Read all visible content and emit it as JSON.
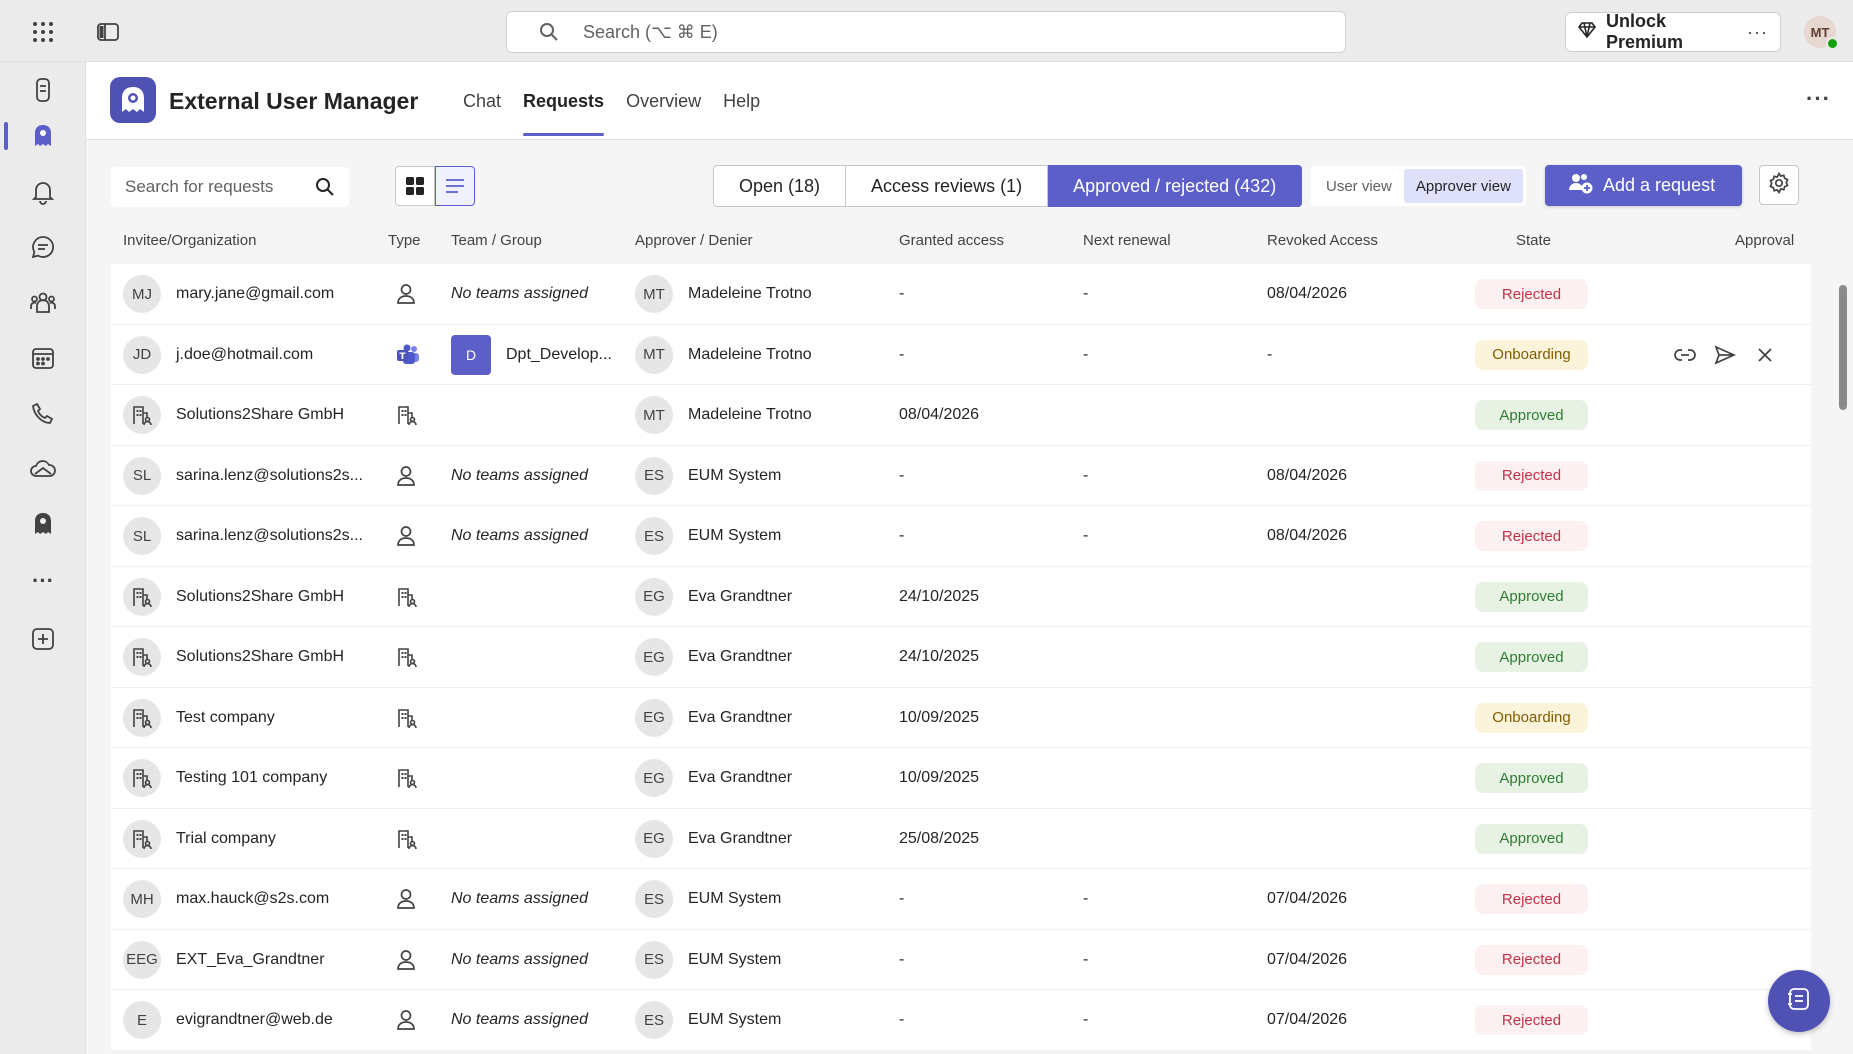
{
  "topbar": {
    "search_placeholder": "Search (⌥ ⌘ E)",
    "premium_label": "Unlock Premium",
    "more_label": "···",
    "avatar_initials": "MT"
  },
  "rail": {
    "items": [
      "app-icon",
      "external-user-manager-icon",
      "bell-icon",
      "chat-icon",
      "teams-icon",
      "calendar-icon",
      "phone-icon",
      "onedrive-icon",
      "app-icon",
      "more-icon",
      "add-app-icon"
    ],
    "more_label": "···"
  },
  "app": {
    "title": "External User Manager",
    "tabs": [
      {
        "label": "Chat"
      },
      {
        "label": "Requests"
      },
      {
        "label": "Overview"
      },
      {
        "label": "Help"
      }
    ],
    "more_label": "···"
  },
  "toolbar": {
    "search_placeholder": "Search for requests",
    "filters": [
      {
        "label": "Open (18)"
      },
      {
        "label": "Access reviews (1)"
      },
      {
        "label": "Approved / rejected (432)"
      }
    ],
    "views": [
      {
        "label": "User view"
      },
      {
        "label": "Approver view"
      }
    ],
    "add_label": "Add a request"
  },
  "table": {
    "columns": [
      "Invitee/Organization",
      "Type",
      "Team / Group",
      "Approver / Denier",
      "Granted access",
      "Next renewal",
      "Revoked Access",
      "State",
      "Approval"
    ],
    "rows": [
      {
        "avatar": "MJ",
        "invitee": "mary.jane@gmail.com",
        "type": "user",
        "team": "No teams assigned",
        "appr_av": "MT",
        "approver": "Madeleine Trotno",
        "granted": "-",
        "renewal": "-",
        "revoked": "08/04/2026",
        "state": "Rejected",
        "actions": false
      },
      {
        "avatar": "JD",
        "invitee": "j.doe@hotmail.com",
        "type": "teams",
        "team": "Dpt_Develop...",
        "team_badge": "D",
        "appr_av": "MT",
        "approver": "Madeleine Trotno",
        "granted": "-",
        "renewal": "-",
        "revoked": "-",
        "state": "Onboarding",
        "actions": true
      },
      {
        "avatar": "",
        "invitee": "Solutions2Share GmbH",
        "type": "org",
        "team": "",
        "appr_av": "MT",
        "approver": "Madeleine Trotno",
        "granted": "08/04/2026",
        "renewal": "",
        "revoked": "",
        "state": "Approved",
        "actions": false
      },
      {
        "avatar": "SL",
        "invitee": "sarina.lenz@solutions2s...",
        "type": "user",
        "team": "No teams assigned",
        "appr_av": "ES",
        "approver": "EUM System",
        "granted": "-",
        "renewal": "-",
        "revoked": "08/04/2026",
        "state": "Rejected",
        "actions": false
      },
      {
        "avatar": "SL",
        "invitee": "sarina.lenz@solutions2s...",
        "type": "user",
        "team": "No teams assigned",
        "appr_av": "ES",
        "approver": "EUM System",
        "granted": "-",
        "renewal": "-",
        "revoked": "08/04/2026",
        "state": "Rejected",
        "actions": false
      },
      {
        "avatar": "",
        "invitee": "Solutions2Share GmbH",
        "type": "org",
        "team": "",
        "appr_av": "EG",
        "approver": "Eva Grandtner",
        "granted": "24/10/2025",
        "renewal": "",
        "revoked": "",
        "state": "Approved",
        "actions": false
      },
      {
        "avatar": "",
        "invitee": "Solutions2Share GmbH",
        "type": "org",
        "team": "",
        "appr_av": "EG",
        "approver": "Eva Grandtner",
        "granted": "24/10/2025",
        "renewal": "",
        "revoked": "",
        "state": "Approved",
        "actions": false
      },
      {
        "avatar": "",
        "invitee": "Test company",
        "type": "org",
        "team": "",
        "appr_av": "EG",
        "approver": "Eva Grandtner",
        "granted": "10/09/2025",
        "renewal": "",
        "revoked": "",
        "state": "Onboarding",
        "actions": false
      },
      {
        "avatar": "",
        "invitee": "Testing 101 company",
        "type": "org",
        "team": "",
        "appr_av": "EG",
        "approver": "Eva Grandtner",
        "granted": "10/09/2025",
        "renewal": "",
        "revoked": "",
        "state": "Approved",
        "actions": false
      },
      {
        "avatar": "",
        "invitee": "Trial company",
        "type": "org",
        "team": "",
        "appr_av": "EG",
        "approver": "Eva Grandtner",
        "granted": "25/08/2025",
        "renewal": "",
        "revoked": "",
        "state": "Approved",
        "actions": false
      },
      {
        "avatar": "MH",
        "invitee": "max.hauck@s2s.com",
        "type": "user",
        "team": "No teams assigned",
        "appr_av": "ES",
        "approver": "EUM System",
        "granted": "-",
        "renewal": "-",
        "revoked": "07/04/2026",
        "state": "Rejected",
        "actions": false
      },
      {
        "avatar": "EEG",
        "invitee": "EXT_Eva_Grandtner",
        "type": "user",
        "team": "No teams assigned",
        "appr_av": "ES",
        "approver": "EUM System",
        "granted": "-",
        "renewal": "-",
        "revoked": "07/04/2026",
        "state": "Rejected",
        "actions": false
      },
      {
        "avatar": "E",
        "invitee": "evigrandtner@web.de",
        "type": "user",
        "team": "No teams assigned",
        "appr_av": "ES",
        "approver": "EUM System",
        "granted": "-",
        "renewal": "-",
        "revoked": "07/04/2026",
        "state": "Rejected",
        "actions": false
      }
    ]
  },
  "colors": {
    "accent": "#5b5fc7",
    "rejected": "#c4314b",
    "approved": "#2e7d32",
    "onboarding": "#835b00"
  }
}
